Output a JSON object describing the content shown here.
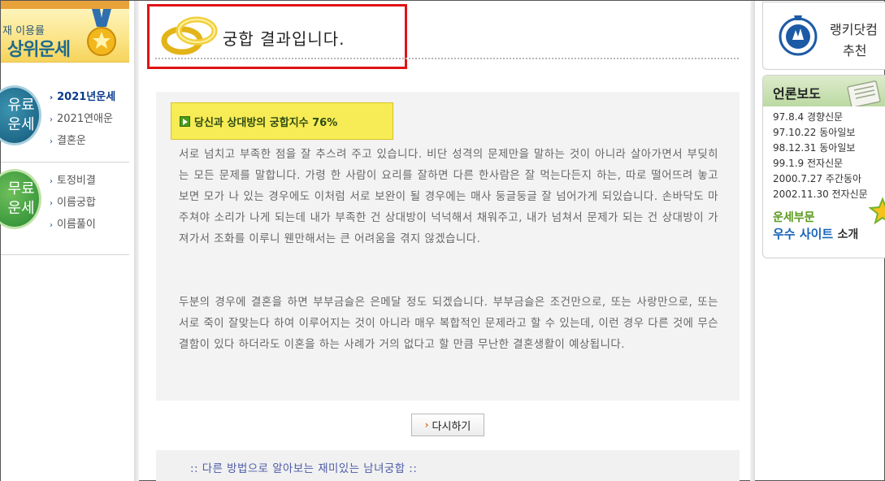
{
  "left_banner": {
    "small_text": "재 이용률",
    "big_text": "상위운세"
  },
  "paid_menu": {
    "badge": "유료\n운세",
    "badge_line1": "유료",
    "badge_line2": "운세",
    "items": [
      {
        "label": "2021년운세",
        "active": true
      },
      {
        "label": "2021연애운",
        "active": false
      },
      {
        "label": "결혼운",
        "active": false
      }
    ]
  },
  "free_menu": {
    "badge_line1": "무료",
    "badge_line2": "운세",
    "items": [
      {
        "label": "토정비결"
      },
      {
        "label": "이름궁합"
      },
      {
        "label": "이름풀이"
      }
    ]
  },
  "main": {
    "title": "궁합 결과입니다.",
    "score_label": "당신과 상대방의 궁합지수 76%",
    "score_percent": 76,
    "paragraph1": "서로 넘치고 부족한 점을 잘 추스려 주고 있습니다. 비단 성격의 문제만을 말하는 것이 아니라 살아가면서 부딪히는 모든 문제를 말합니다. 가령 한 사람이 요리를 잘하면 다른 한사람은 잘 먹는다든지 하는, 따로 떨어뜨려 놓고 보면 모가 나 있는 경우에도 이처럼 서로 보완이 될 경우에는 매사 둥글둥글 잘 넘어가게 되있습니다. 손바닥도 마주쳐야 소리가 나게 되는데 내가 부족한 건 상대방이 넉넉해서 채워주고, 내가 넘쳐서 문제가 되는 건 상대방이 가져가서 조화를 이루니 웬만해서는 큰 어려움을 겪지 않겠습니다.",
    "paragraph2": "두분의 경우에 결혼을 하면 부부금슬은 은메달 정도 되겠습니다. 부부금슬은 조건만으로, 또는 사랑만으로, 또는 서로 죽이 잘맞는다 하여 이루어지는 것이 아니라 매우 복합적인 문제라고 할 수 있는데, 이런 경우 다른 것에 무슨 결함이 있다 하더라도 이혼을 하는 사례가 거의 없다고 할 만큼 무난한 결혼생활이 예상됩니다.",
    "retry_label": "다시하기",
    "other_methods": ":: 다른 방법으로 알아보는 재미있는 남녀궁합 ::"
  },
  "right": {
    "rank_title": "랭키닷컴",
    "rank_sub": "추천",
    "press_title": "언론보도",
    "press_items": [
      "97.8.4 경향신문",
      "97.10.22 동아일보",
      "98.12.31 동아일보",
      "99.1.9 전자신문",
      "2000.7.27 주간동아",
      "2002.11.30 전자신문"
    ],
    "award_line1": "운세부문",
    "award_line2_strong": "우수 사이트",
    "award_line2_rest": "소개"
  },
  "colors": {
    "title_border": "#e01414",
    "score_bg": "#f7ec55",
    "text_gray": "#666666",
    "other_methods_text": "#4b5aa6"
  }
}
